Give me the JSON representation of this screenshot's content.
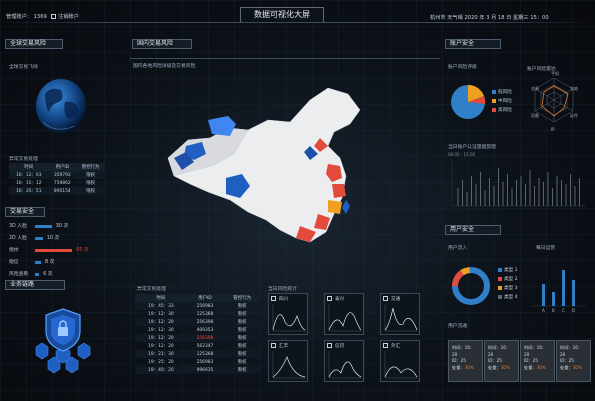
{
  "header": {
    "user_label": "管理账户：",
    "user_value": "1369",
    "logout_label": "注销账户",
    "title": "数据可视化大屏",
    "city": "杭州市",
    "weather": "天气晴",
    "datetime": "2020 年 3 月 18 日  星期三  15：00"
  },
  "left": {
    "global_risk_title": "全球交易风险",
    "global_flight_label": "全球交易飞线",
    "abnormal_title": "异常交易处理",
    "abnormal_headers": [
      "时间",
      "用户ID",
      "管控行为"
    ],
    "abnormal_rows": [
      [
        "16：12：03",
        "359793",
        "限权"
      ],
      [
        "16：15：12",
        "759862",
        "限权"
      ],
      [
        "16：35：51",
        "895154",
        "限权"
      ]
    ],
    "trade_security_title": "交易安全",
    "stats": [
      {
        "label": "3D 人脸",
        "value": "30 次",
        "fill": 0.28,
        "color": "#2f7fc9"
      },
      {
        "label": "2D 人脸",
        "value": "10 次",
        "fill": 0.13,
        "color": "#2f7fc9"
      },
      {
        "label": "指纹",
        "value": "65 次",
        "fill": 0.62,
        "color": "#e24a3b"
      },
      {
        "label": "短信",
        "value": "8 次",
        "fill": 0.1,
        "color": "#2f7fc9"
      },
      {
        "label": "风险查看",
        "value": "6 次",
        "fill": 0.07,
        "color": "#2f7fc9"
      }
    ],
    "business_link_title": "业务链路"
  },
  "center": {
    "domestic_title": "国内交易风险",
    "domestic_sub": "国内各地风险详级及交易风险",
    "abnormal_title": "异常交易处理",
    "headers": [
      "时间",
      "用户ID",
      "管控行为"
    ],
    "rows": [
      [
        "19：45：33",
        "256983",
        "限权"
      ],
      [
        "19：12：30",
        "125368",
        "限权"
      ],
      [
        "19：12：20",
        "256398",
        "限权"
      ],
      [
        "19：12：30",
        "409353",
        "限权"
      ],
      [
        "19：12：20",
        "256398",
        "限权"
      ],
      [
        "19：12：20",
        "562347",
        "限权"
      ],
      [
        "19：21：30",
        "125368",
        "限权"
      ],
      [
        "19：25：20",
        "256983",
        "限权"
      ],
      [
        "19：40：20",
        "996635",
        "限权"
      ]
    ],
    "red_row_index": 4,
    "risk_stats_title": "当日风险统计",
    "mini_labels": [
      "四川",
      "泰兴",
      "交通",
      "汇丰",
      "信贷",
      "外汇"
    ]
  },
  "right": {
    "account_security_title": "账户安全",
    "account_risk_label": "账户风险评级",
    "pie_legend": [
      {
        "label": "低风险",
        "color": "#2f7fc9"
      },
      {
        "label": "中风险",
        "color": "#f0a020"
      },
      {
        "label": "高风险",
        "color": "#e24a3b"
      }
    ],
    "radar_title": "账户风险雷达",
    "radar_labels": [
      "手机",
      "冻结",
      "证件",
      "IP",
      "设备",
      "交易"
    ],
    "chart_title": "当日账户认证量趋势图",
    "chart_axis_label": "08:00 - 15:00",
    "user_security_title": "用户安全",
    "user_inflow_label": "用户流入",
    "daily_ops_label": "每日运营",
    "donut_legend": [
      {
        "label": "类型 1",
        "color": "#2f7fc9"
      },
      {
        "label": "类型 2",
        "color": "#e24a3b"
      },
      {
        "label": "类型 3",
        "color": "#f0a020"
      },
      {
        "label": "类型 4",
        "color": "#5a6a7a"
      }
    ],
    "bar_ticks": [
      "A",
      "B",
      "C",
      "D"
    ],
    "user_flow_label": "用户流通",
    "cards": [
      {
        "time": "时间：16：20",
        "id": "ID：25",
        "amount": "处量：",
        "amount_value": "30%"
      },
      {
        "time": "时间：16：20",
        "id": "ID：25",
        "amount": "处量：",
        "amount_value": "30%"
      },
      {
        "time": "时间：16：20",
        "id": "ID：25",
        "amount": "处量：",
        "amount_value": "30%"
      },
      {
        "time": "时间：16：20",
        "id": "ID：25",
        "amount": "处量：",
        "amount_value": "30%"
      }
    ]
  }
}
